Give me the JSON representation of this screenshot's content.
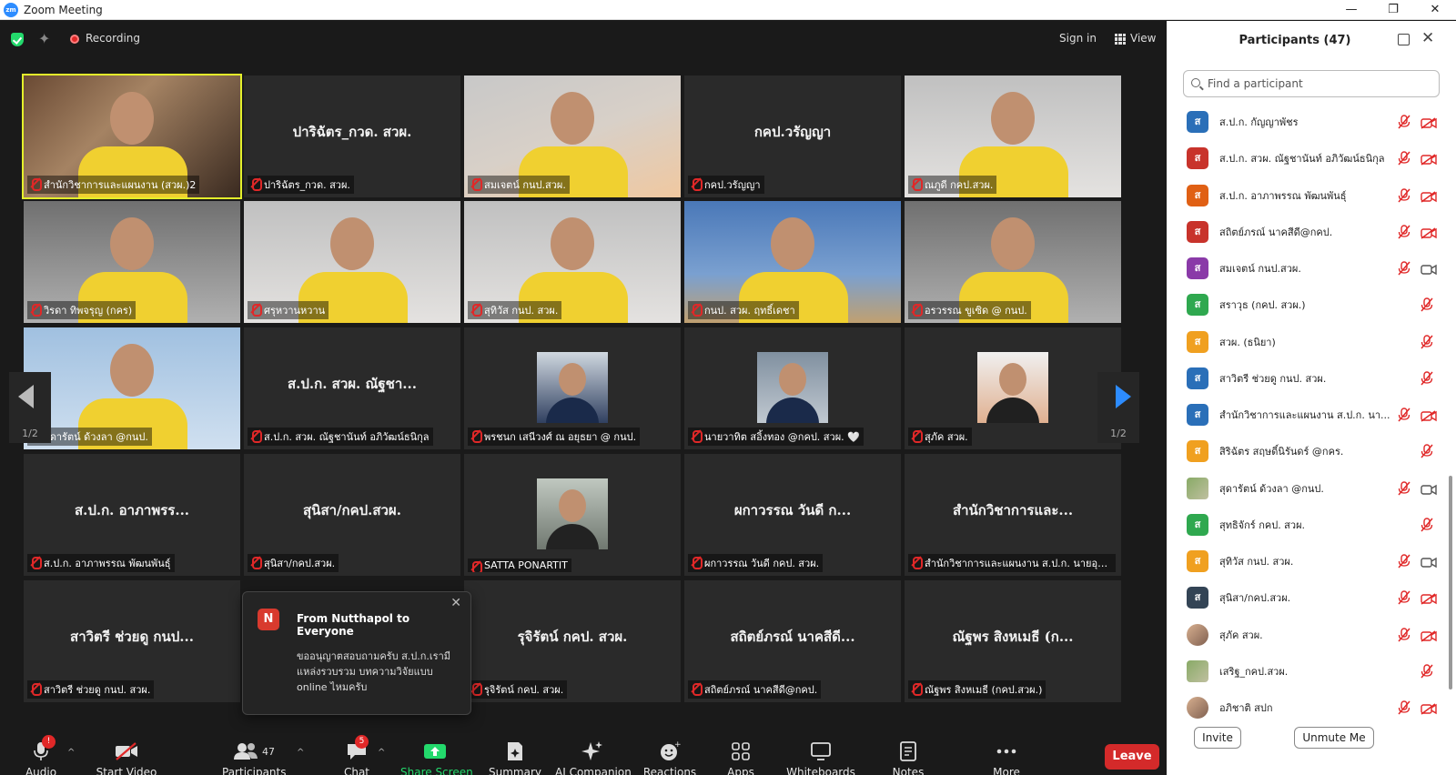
{
  "window": {
    "logo": "zm",
    "title": "Zoom Meeting",
    "controls": [
      "—",
      "❐",
      "✕"
    ]
  },
  "topbar": {
    "recording_label": "Recording",
    "signin_label": "Sign in",
    "view_label": "View"
  },
  "tiles": [
    {
      "label": "สำนักวิชาการและแผนงาน (สวผ.)2",
      "big": "",
      "kind": "cam1",
      "active": true
    },
    {
      "label": "ปาริฉัตร_กวด. สวผ.",
      "big": "ปาริฉัตร_กวด. สวผ.",
      "kind": "none"
    },
    {
      "label": "สมเจตน์ กนป.สวผ.",
      "big": "",
      "kind": "cam2"
    },
    {
      "label": "กคป.วรัญญา",
      "big": "กคป.วรัญญา",
      "kind": "none"
    },
    {
      "label": "ณภูดี กคป.สวผ.",
      "big": "",
      "kind": "cam3"
    },
    {
      "label": "วิรดา ทิพจรุญ (กคร)",
      "big": "",
      "kind": "cam5"
    },
    {
      "label": "ศรุหวานหวาน",
      "big": "",
      "kind": "cam3"
    },
    {
      "label": "สุทิวัส กนป. สวผ.",
      "big": "",
      "kind": "cam3"
    },
    {
      "label": "กนป. สวผ. ฤทธิ์เดชา",
      "big": "",
      "kind": "cam4"
    },
    {
      "label": "อรวรรณ ขูเซิด @ กนป.",
      "big": "",
      "kind": "cam5"
    },
    {
      "label": "สุดารัตน์ ด้วงลา @กนป.",
      "big": "",
      "kind": "cam6"
    },
    {
      "label": "ส.ป.ก. สวผ. ณัฐชานันท์ อภิวัฒน์ธนิกุล",
      "big": "ส.ป.ก. สวผ. ณัฐชา...",
      "kind": "none"
    },
    {
      "label": "พรชนก เสนีวงศ์ ณ อยุธยา @ กนป.",
      "big": "",
      "kind": "thumb1"
    },
    {
      "label": "นายวาทิต สอิ้งทอง @กคป. สวผ. 🤍",
      "big": "",
      "kind": "thumb2"
    },
    {
      "label": "สุภัค สวผ.",
      "big": "",
      "kind": "thumb3"
    },
    {
      "label": "ส.ป.ก. อาภาพรรณ พัฒนพันธุ์",
      "big": "ส.ป.ก. อาภาพรร...",
      "kind": "none"
    },
    {
      "label": "สุนิสา/กคป.สวผ.",
      "big": "สุนิสา/กคป.สวผ.",
      "kind": "none"
    },
    {
      "label": "SATTA PONARTIT",
      "big": "",
      "kind": "thumb4"
    },
    {
      "label": "ผกาวรรณ วันดี กคป. สวผ.",
      "big": "ผกาวรรณ วันดี ก...",
      "kind": "none"
    },
    {
      "label": "สำนักวิชาการและแผนงาน ส.ป.ก. นายอุกฤ...",
      "big": "สำนักวิชาการและ...",
      "kind": "none"
    },
    {
      "label": "สาวิตรี ช่วยดู กนป. สวผ.",
      "big": "สาวิตรี ช่วยดู กนป...",
      "kind": "none"
    },
    {
      "label": "",
      "big": "",
      "kind": "none"
    },
    {
      "label": "รุจิรัตน์ กคป. สวผ.",
      "big": "รุจิรัตน์ กคป. สวผ.",
      "kind": "none"
    },
    {
      "label": "สถิตย์ภรณ์ นาคสีดี@กคป.",
      "big": "สถิตย์ภรณ์ นาคสีดี...",
      "kind": "none"
    },
    {
      "label": "ณัฐพร สิงหเมธี (กคป.สวผ.)",
      "big": "ณัฐพร สิงหเมธี (ก...",
      "kind": "none"
    }
  ],
  "pager": {
    "left": "1/2",
    "right": "1/2"
  },
  "chat_popup": {
    "initial": "N",
    "from": "From Nutthapol to Everyone",
    "message": "ขออนุญาตสอบถามครับ ส.ป.ก.เรามีแหล่งรวบรวม บทความวิจัยแบบ online ไหมครับ",
    "close": "✕"
  },
  "toolbar": {
    "audio": "Audio",
    "audio_badge": "!",
    "start_video": "Start Video",
    "participants": "Participants",
    "participants_count": "47",
    "chat": "Chat",
    "chat_badge": "5",
    "share_screen": "Share Screen",
    "summary": "Summary",
    "ai_companion": "AI Companion",
    "reactions": "Reactions",
    "apps": "Apps",
    "whiteboards": "Whiteboards",
    "notes": "Notes",
    "more": "More",
    "leave": "Leave"
  },
  "panel": {
    "title": "Participants (47)",
    "search_placeholder": "Find a participant",
    "invite": "Invite",
    "unmute_me": "Unmute Me",
    "participants": [
      {
        "name": "ส.ป.ก. กัญญาพัชร",
        "initial": "ส",
        "color": "#2a6fb8",
        "video": "off"
      },
      {
        "name": "ส.ป.ก. สวผ. ณัฐชานันท์ อภิวัฒน์ธนิกุล",
        "initial": "ส",
        "color": "#c8332b",
        "video": "off"
      },
      {
        "name": "ส.ป.ก. อาภาพรรณ พัฒนพันธุ์",
        "initial": "ส",
        "color": "#e06014",
        "video": "off"
      },
      {
        "name": "สถิตย์ภรณ์ นาคสีดี@กคป.",
        "initial": "ส",
        "color": "#c8332b",
        "video": "off"
      },
      {
        "name": "สมเจตน์ กนป.สวผ.",
        "initial": "ส",
        "color": "#8a3aa8",
        "video": "on"
      },
      {
        "name": "สราวุธ (กคป. สวผ.)",
        "initial": "ส",
        "color": "#2fa84f",
        "video": "none"
      },
      {
        "name": "สวผ. (ธนิยา)",
        "initial": "ส",
        "color": "#f0a020",
        "video": "none"
      },
      {
        "name": "สาวิตรี ช่วยดู กนป. สวผ.",
        "initial": "ส",
        "color": "#2a6fb8",
        "video": "none"
      },
      {
        "name": "สำนักวิชาการและแผนงาน ส.ป.ก. นา...",
        "initial": "ส",
        "color": "#2a6fb8",
        "video": "off"
      },
      {
        "name": "สิริฉัตร สฤษดิ์นิรันดร์ @กคร.",
        "initial": "ส",
        "color": "#f0a020",
        "video": "none"
      },
      {
        "name": "สุดารัตน์ ด้วงลา @กนป.",
        "initial": "",
        "color": "photo2",
        "video": "on"
      },
      {
        "name": "สุทธิจักร์ กคป. สวผ.",
        "initial": "ส",
        "color": "#2fa84f",
        "video": "none"
      },
      {
        "name": "สุทิวัส กนป. สวผ.",
        "initial": "ส",
        "color": "#f0a020",
        "video": "on"
      },
      {
        "name": "สุนิสา/กคป.สวผ.",
        "initial": "ส",
        "color": "#334455",
        "video": "off"
      },
      {
        "name": "สุภัค สวผ.",
        "initial": "",
        "color": "photo",
        "video": "off"
      },
      {
        "name": "เสริฐ_กคป.สวผ.",
        "initial": "",
        "color": "photo2",
        "video": "none"
      },
      {
        "name": "อภิชาติ สปก",
        "initial": "",
        "color": "photo",
        "video": "off"
      }
    ]
  },
  "colors": {
    "accent": "#2d8cff",
    "active_speaker": "#e4f02b",
    "muted_red": "#e02828",
    "share_green": "#23d96c",
    "leave_red": "#d42a2a"
  }
}
